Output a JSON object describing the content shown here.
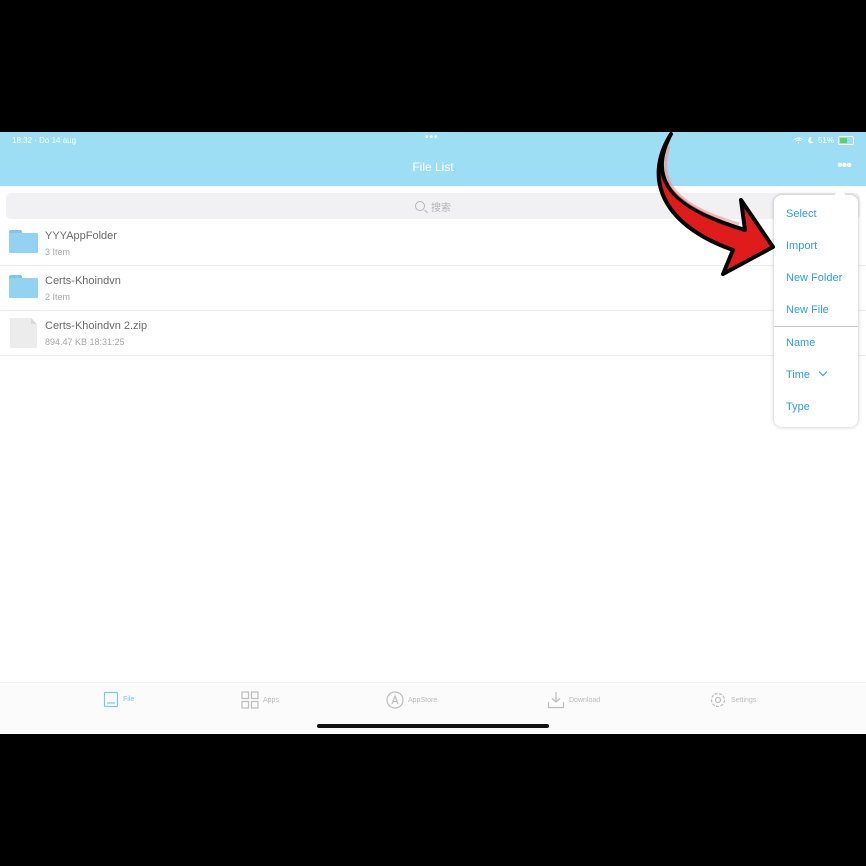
{
  "status": {
    "time": "18:32 · Do 14 aug",
    "dots": "•••",
    "battery": "51%"
  },
  "header": {
    "title": "File List",
    "more_label": "•••"
  },
  "search": {
    "placeholder": "搜索"
  },
  "files": [
    {
      "name": "YYYAppFolder",
      "meta": "3 Item",
      "type": "folder"
    },
    {
      "name": "Certs-Khoindvn",
      "meta": "2 Item",
      "type": "folder"
    },
    {
      "name": "Certs-Khoindvn 2.zip",
      "meta": "894.47 KB   18:31:25",
      "type": "file"
    }
  ],
  "menu": {
    "actions": [
      "Select",
      "Import",
      "New Folder",
      "New File"
    ],
    "sort": [
      "Name",
      "Time",
      "Type"
    ]
  },
  "tabbar": [
    {
      "label": "File",
      "icon": "file-tab-icon",
      "active": true
    },
    {
      "label": "Apps",
      "icon": "apps-grid-icon",
      "active": false
    },
    {
      "label": "AppStore",
      "icon": "appstore-icon",
      "active": false
    },
    {
      "label": "Download",
      "icon": "download-icon",
      "active": false
    },
    {
      "label": "Settings",
      "icon": "gear-icon",
      "active": false
    }
  ],
  "colors": {
    "header": "#9ddef5",
    "accent": "#2aa0d6",
    "arrow": "#e01b1b"
  }
}
